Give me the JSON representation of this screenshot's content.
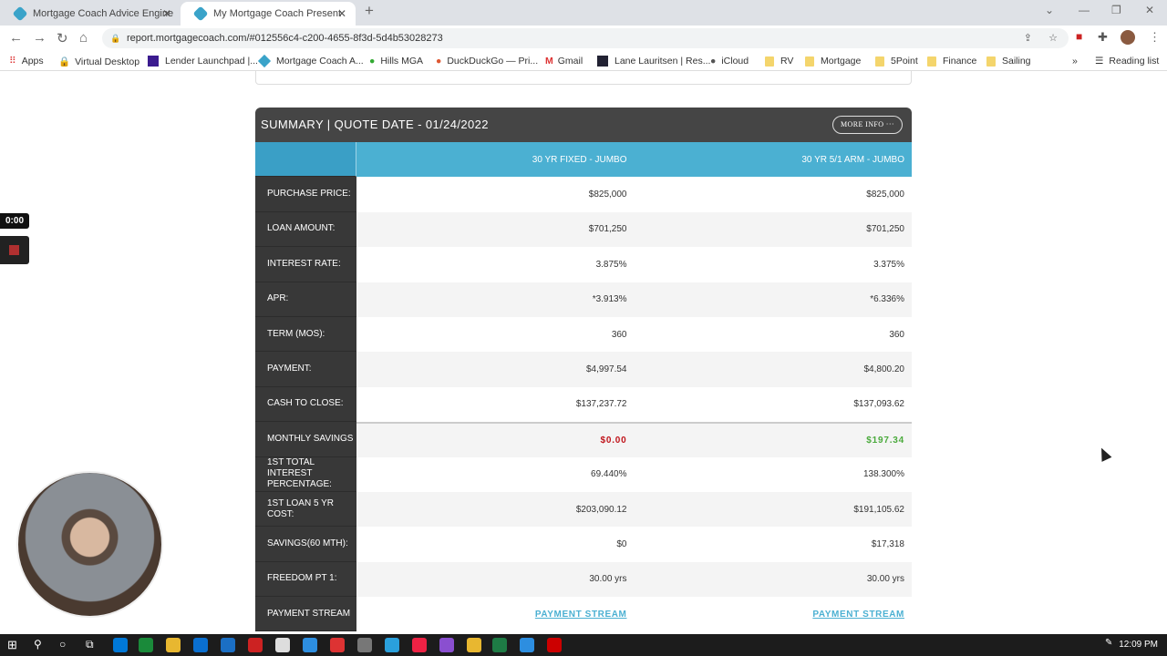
{
  "browser": {
    "tabs": [
      {
        "title": "Mortgage Coach Advice Engine",
        "active": false
      },
      {
        "title": "My Mortgage Coach Presentation",
        "active": true
      }
    ],
    "url": "report.mortgagecoach.com/#012556c4-c200-4655-8f3d-5d4b53028273",
    "bookmarks": [
      "Apps",
      "Virtual Desktop",
      "Lender Launchpad |...",
      "Mortgage Coach A...",
      "Hills MGA",
      "DuckDuckGo — Pri...",
      "Gmail",
      "Lane Lauritsen | Res...",
      "iCloud",
      "RV",
      "Mortgage",
      "5Point",
      "Finance",
      "Sailing"
    ],
    "reading_list": "Reading list",
    "more_bookmarks": "»"
  },
  "summary": {
    "title": "SUMMARY | QUOTE DATE - 01/24/2022",
    "more_info": "MORE INFO  ···",
    "columns": [
      "30 YR FIXED - JUMBO",
      "30 YR 5/1 ARM - JUMBO"
    ],
    "rows": [
      {
        "label": "PURCHASE PRICE:",
        "values": [
          "$825,000",
          "$825,000"
        ]
      },
      {
        "label": "LOAN AMOUNT:",
        "values": [
          "$701,250",
          "$701,250"
        ]
      },
      {
        "label": "INTEREST RATE:",
        "values": [
          "3.875%",
          "3.375%"
        ]
      },
      {
        "label": "APR:",
        "values": [
          "*3.913%",
          "*6.336%"
        ]
      },
      {
        "label": "TERM (MOS):",
        "values": [
          "360",
          "360"
        ]
      },
      {
        "label": "PAYMENT:",
        "values": [
          "$4,997.54",
          "$4,800.20"
        ]
      },
      {
        "label": "CASH TO CLOSE:",
        "values": [
          "$137,237.72",
          "$137,093.62"
        ]
      },
      {
        "label": "MONTHLY SAVINGS",
        "values": [
          "$0.00",
          "$197.34"
        ]
      },
      {
        "label": "1ST TOTAL INTEREST PERCENTAGE:",
        "values": [
          "69.440%",
          "138.300%"
        ]
      },
      {
        "label": "1ST LOAN 5 YR COST:",
        "values": [
          "$203,090.12",
          "$191,105.62"
        ]
      },
      {
        "label": "SAVINGS(60 MTH):",
        "values": [
          "$0",
          "$17,318"
        ]
      },
      {
        "label": "FREEDOM PT 1:",
        "values": [
          "30.00 yrs",
          "30.00 yrs"
        ]
      },
      {
        "label": "PAYMENT STREAM",
        "values": [
          "PAYMENT STREAM",
          "PAYMENT STREAM"
        ]
      }
    ]
  },
  "recorder": {
    "time": "0:00"
  },
  "taskbar": {
    "clock": "12:09 PM"
  },
  "colors": {
    "header": "#454545",
    "column_header": "#4bb0d2",
    "negative": "#c0141b",
    "positive": "#4aaa3c"
  }
}
